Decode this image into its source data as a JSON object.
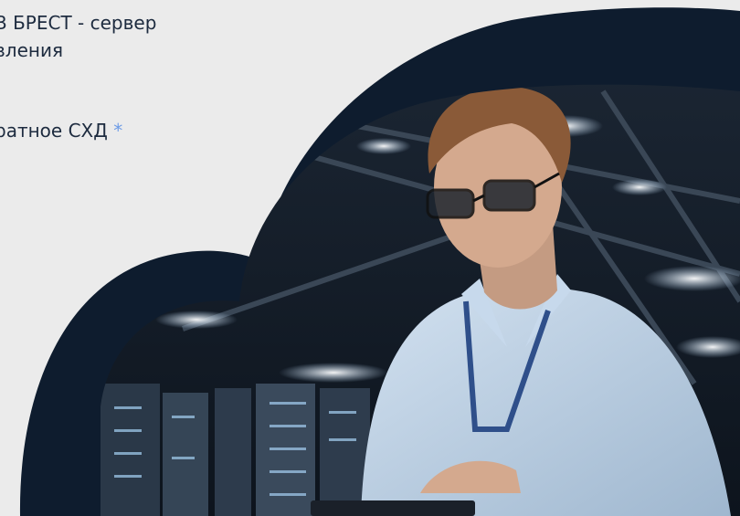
{
  "intro": {
    "line1": "В БРЕСТ - сервер",
    "line1b": "вления",
    "line2": "ратное СХД",
    "required_mark": "*"
  },
  "colors": {
    "cloud_outline": "#0e1c2e",
    "background": "#ebebeb",
    "accent": "#6d9be6"
  },
  "hero_image": {
    "icon": "engineer-with-tablet-in-data-center-photo"
  }
}
